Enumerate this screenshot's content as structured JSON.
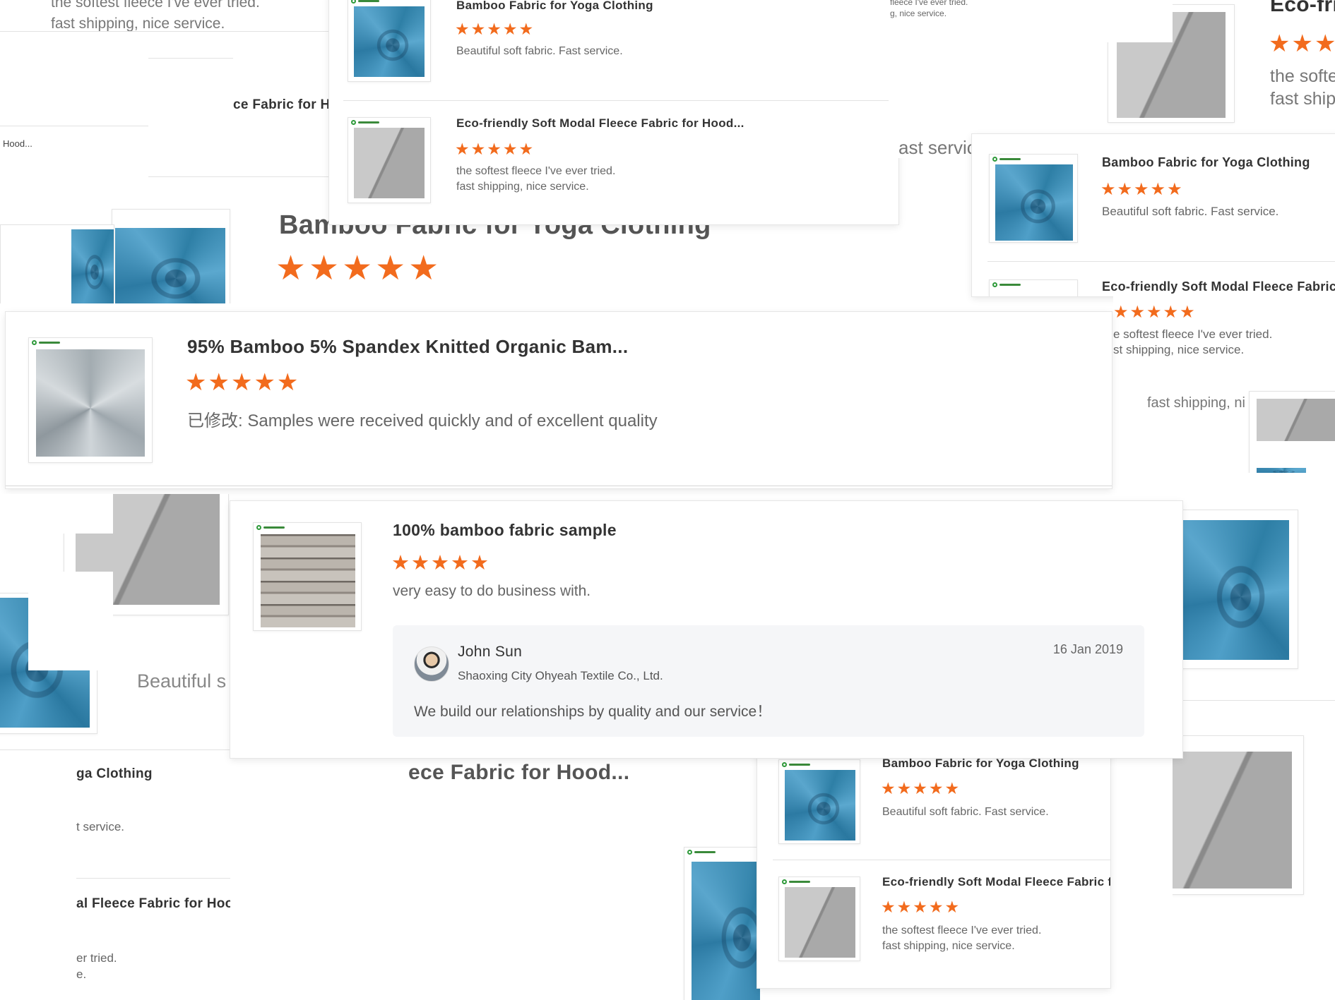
{
  "colors": {
    "accent_star": "#f26b1d",
    "title_text": "#333333",
    "body_text": "#666666"
  },
  "star_glyph": "★★★★★",
  "rating": 5,
  "reviews": {
    "bamboo_yoga": {
      "title": "Bamboo Fabric for Yoga Clothing",
      "comment": "Beautiful soft fabric. Fast service."
    },
    "modal_fleece": {
      "title": "Eco-friendly Soft Modal Fleece Fabric for Hood...",
      "comment_line1": "the softest fleece I've ever tried.",
      "comment_line2": "fast shipping, nice service."
    },
    "bamboo_spandex": {
      "title": "95% Bamboo 5% Spandex Knitted Organic Bam...",
      "comment": "已修改: Samples were received quickly and of excellent quality"
    },
    "bamboo_sample": {
      "title": "100% bamboo fabric sample",
      "comment": "very easy to do business with.",
      "reply": {
        "name": "John Sun",
        "company": "Shaoxing City Ohyeah Textile Co., Ltd.",
        "date": "16 Jan 2019",
        "message": "We build our relationships by quality and our service！"
      }
    }
  },
  "fragments": {
    "tl_line1": "the softest fleece I've ever tried.",
    "tl_line2": "fast shipping, nice service.",
    "ce_fabric": "ce Fabric for H",
    "hood": "Hood...",
    "big_bamboo": "Bamboo Fabric for Yoga Clothing",
    "fleece_tiny1": "fleece I've ever tried.",
    "fleece_tiny2": "g, nice service.",
    "ast_service": "ast servic",
    "eco_fri": "Eco-fri",
    "the_softe": "the softe",
    "fast_ship": "fast ship",
    "e_softest": "e softest fleece I've ever tried.",
    "st_shipping": "st shipping, nice service.",
    "fast_shipping_ni": "fast shipping, ni",
    "beautiful_s": "Beautiful s",
    "ga_clothing": "ga Clothing",
    "t_service": "t service.",
    "ece_fabric": "ece Fabric for Hood...",
    "al_fleece": "al Fleece Fabric for Hood...",
    "er_tried": "er tried.",
    "e_dot": "e."
  }
}
